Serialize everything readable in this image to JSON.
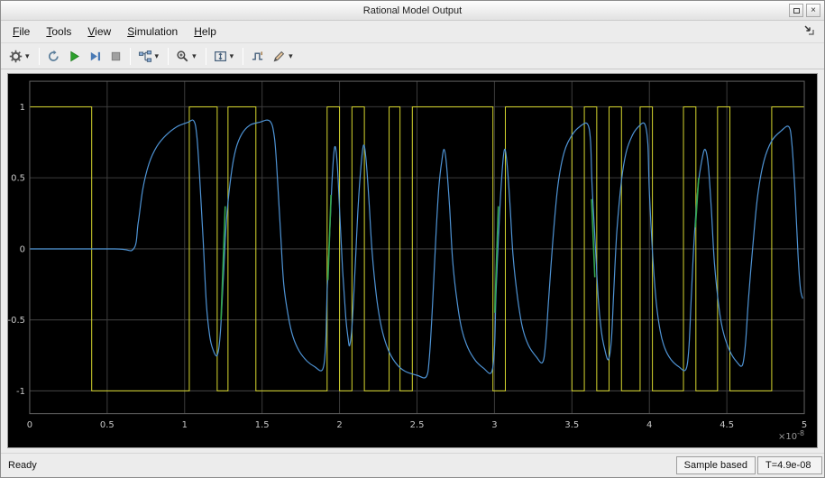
{
  "window": {
    "title": "Rational Model Output",
    "close_glyph": "×"
  },
  "menu": {
    "items": [
      {
        "label": "File"
      },
      {
        "label": "Tools"
      },
      {
        "label": "View"
      },
      {
        "label": "Simulation"
      },
      {
        "label": "Help"
      }
    ]
  },
  "toolbar": {
    "groups": [
      [
        {
          "name": "configuration",
          "icon": "gear-icon",
          "dropdown": true
        }
      ],
      [
        {
          "name": "step-back",
          "icon": "step-back-icon"
        },
        {
          "name": "run",
          "icon": "run-icon"
        },
        {
          "name": "step-forward",
          "icon": "step-forward-icon"
        },
        {
          "name": "stop",
          "icon": "stop-icon"
        }
      ],
      [
        {
          "name": "signal-selector",
          "icon": "signal-selector-icon",
          "dropdown": true
        }
      ],
      [
        {
          "name": "zoom",
          "icon": "zoom-icon",
          "dropdown": true
        }
      ],
      [
        {
          "name": "scale-axes",
          "icon": "scale-axes-icon",
          "dropdown": true
        }
      ],
      [
        {
          "name": "trigger",
          "icon": "trigger-icon"
        },
        {
          "name": "measurements",
          "icon": "measurements-icon",
          "dropdown": true
        }
      ]
    ]
  },
  "statusbar": {
    "ready": "Ready",
    "cells": [
      "Sample based",
      "T=4.9e-08"
    ]
  },
  "chart_data": {
    "type": "line",
    "title": "",
    "xlabel": "",
    "ylabel": "",
    "xlim": [
      0,
      5
    ],
    "ylim": [
      -1.16,
      1.18
    ],
    "x_scale_label": {
      "base": "×10",
      "exponent": "-8"
    },
    "grid": true,
    "background": "#000000",
    "grid_color": "#3d3d3d",
    "axes_border_color": "#606060",
    "tick_color": "#c8c8c8",
    "scale_label_color": "#9a9a9a",
    "xtick_values": [
      0,
      0.5,
      1,
      1.5,
      2,
      2.5,
      3,
      3.5,
      4,
      4.5,
      5
    ],
    "xtick_labels": [
      "0",
      "0.5",
      "1",
      "1.5",
      "2",
      "2.5",
      "3",
      "3.5",
      "4",
      "4.5",
      "5"
    ],
    "ytick_values": [
      1,
      0.5,
      0,
      -0.5,
      -1
    ],
    "ytick_labels": [
      "1",
      "0.5",
      "0",
      "-0.5",
      "-1"
    ],
    "series": [
      {
        "name": "input-square-wave",
        "color": "#d6d62e",
        "type": "step",
        "initial_value": 1,
        "levels": [
          1,
          -1
        ],
        "transition_times": [
          0.4,
          1.03,
          1.21,
          1.28,
          1.46,
          1.92,
          2.0,
          2.08,
          2.16,
          2.32,
          2.39,
          2.47,
          2.99,
          3.07,
          3.5,
          3.58,
          3.66,
          3.74,
          3.82,
          3.94,
          4.02,
          4.22,
          4.3,
          4.44,
          4.52,
          4.79
        ]
      },
      {
        "name": "output-response",
        "color": "#4e93d4",
        "type": "smooth",
        "points": [
          [
            0,
            0
          ],
          [
            0.55,
            0
          ],
          [
            0.67,
            0
          ],
          [
            0.7,
            0.18
          ],
          [
            0.73,
            0.42
          ],
          [
            0.77,
            0.6
          ],
          [
            0.82,
            0.72
          ],
          [
            0.88,
            0.8
          ],
          [
            0.95,
            0.86
          ],
          [
            1.02,
            0.89
          ],
          [
            1.06,
            0.9
          ],
          [
            1.08,
            0.78
          ],
          [
            1.1,
            0.45
          ],
          [
            1.12,
            0.05
          ],
          [
            1.14,
            -0.38
          ],
          [
            1.16,
            -0.6
          ],
          [
            1.18,
            -0.7
          ],
          [
            1.21,
            -0.75
          ],
          [
            1.23,
            -0.6
          ],
          [
            1.25,
            -0.2
          ],
          [
            1.27,
            0.2
          ],
          [
            1.3,
            0.52
          ],
          [
            1.33,
            0.7
          ],
          [
            1.37,
            0.81
          ],
          [
            1.42,
            0.87
          ],
          [
            1.48,
            0.89
          ],
          [
            1.55,
            0.9
          ],
          [
            1.58,
            0.78
          ],
          [
            1.6,
            0.48
          ],
          [
            1.62,
            0.1
          ],
          [
            1.64,
            -0.25
          ],
          [
            1.67,
            -0.48
          ],
          [
            1.7,
            -0.62
          ],
          [
            1.74,
            -0.72
          ],
          [
            1.79,
            -0.79
          ],
          [
            1.84,
            -0.83
          ],
          [
            1.89,
            -0.85
          ],
          [
            1.91,
            -0.68
          ],
          [
            1.92,
            -0.3
          ],
          [
            1.94,
            0.2
          ],
          [
            1.955,
            0.55
          ],
          [
            1.97,
            0.72
          ],
          [
            1.985,
            0.6
          ],
          [
            2.0,
            0.28
          ],
          [
            2.02,
            -0.15
          ],
          [
            2.04,
            -0.48
          ],
          [
            2.055,
            -0.63
          ],
          [
            2.065,
            -0.68
          ],
          [
            2.08,
            -0.55
          ],
          [
            2.1,
            -0.15
          ],
          [
            2.12,
            0.3
          ],
          [
            2.14,
            0.6
          ],
          [
            2.155,
            0.73
          ],
          [
            2.17,
            0.64
          ],
          [
            2.19,
            0.34
          ],
          [
            2.21,
            -0.02
          ],
          [
            2.24,
            -0.35
          ],
          [
            2.27,
            -0.55
          ],
          [
            2.31,
            -0.7
          ],
          [
            2.36,
            -0.8
          ],
          [
            2.42,
            -0.86
          ],
          [
            2.5,
            -0.89
          ],
          [
            2.56,
            -0.9
          ],
          [
            2.58,
            -0.76
          ],
          [
            2.6,
            -0.4
          ],
          [
            2.62,
            0.05
          ],
          [
            2.64,
            0.42
          ],
          [
            2.66,
            0.62
          ],
          [
            2.675,
            0.7
          ],
          [
            2.69,
            0.6
          ],
          [
            2.71,
            0.3
          ],
          [
            2.73,
            -0.08
          ],
          [
            2.76,
            -0.38
          ],
          [
            2.79,
            -0.57
          ],
          [
            2.83,
            -0.7
          ],
          [
            2.88,
            -0.79
          ],
          [
            2.93,
            -0.84
          ],
          [
            2.98,
            -0.87
          ],
          [
            3.0,
            -0.7
          ],
          [
            3.01,
            -0.32
          ],
          [
            3.03,
            0.18
          ],
          [
            3.05,
            0.55
          ],
          [
            3.065,
            0.7
          ],
          [
            3.08,
            0.61
          ],
          [
            3.1,
            0.32
          ],
          [
            3.12,
            -0.05
          ],
          [
            3.15,
            -0.35
          ],
          [
            3.18,
            -0.55
          ],
          [
            3.22,
            -0.68
          ],
          [
            3.27,
            -0.76
          ],
          [
            3.31,
            -0.8
          ],
          [
            3.33,
            -0.67
          ],
          [
            3.35,
            -0.35
          ],
          [
            3.38,
            0.1
          ],
          [
            3.41,
            0.45
          ],
          [
            3.45,
            0.68
          ],
          [
            3.5,
            0.8
          ],
          [
            3.55,
            0.86
          ],
          [
            3.6,
            0.88
          ],
          [
            3.62,
            0.76
          ],
          [
            3.63,
            0.45
          ],
          [
            3.65,
            0.05
          ],
          [
            3.67,
            -0.35
          ],
          [
            3.69,
            -0.58
          ],
          [
            3.71,
            -0.7
          ],
          [
            3.735,
            -0.78
          ],
          [
            3.755,
            -0.64
          ],
          [
            3.77,
            -0.3
          ],
          [
            3.79,
            0.12
          ],
          [
            3.82,
            0.48
          ],
          [
            3.85,
            0.68
          ],
          [
            3.89,
            0.8
          ],
          [
            3.93,
            0.86
          ],
          [
            3.97,
            0.88
          ],
          [
            3.99,
            0.74
          ],
          [
            4.0,
            0.4
          ],
          [
            4.02,
            -0.02
          ],
          [
            4.045,
            -0.38
          ],
          [
            4.07,
            -0.58
          ],
          [
            4.1,
            -0.7
          ],
          [
            4.14,
            -0.78
          ],
          [
            4.19,
            -0.83
          ],
          [
            4.235,
            -0.85
          ],
          [
            4.255,
            -0.7
          ],
          [
            4.27,
            -0.35
          ],
          [
            4.29,
            0.08
          ],
          [
            4.315,
            0.45
          ],
          [
            4.34,
            0.63
          ],
          [
            4.36,
            0.7
          ],
          [
            4.38,
            0.59
          ],
          [
            4.4,
            0.28
          ],
          [
            4.42,
            -0.1
          ],
          [
            4.45,
            -0.42
          ],
          [
            4.48,
            -0.6
          ],
          [
            4.52,
            -0.72
          ],
          [
            4.56,
            -0.79
          ],
          [
            4.6,
            -0.82
          ],
          [
            4.62,
            -0.67
          ],
          [
            4.64,
            -0.35
          ],
          [
            4.67,
            0.05
          ],
          [
            4.7,
            0.38
          ],
          [
            4.74,
            0.62
          ],
          [
            4.79,
            0.76
          ],
          [
            4.85,
            0.83
          ],
          [
            4.9,
            0.86
          ],
          [
            4.92,
            0.74
          ],
          [
            4.94,
            0.4
          ],
          [
            4.96,
            -0.05
          ],
          [
            4.975,
            -0.28
          ],
          [
            4.99,
            -0.35
          ]
        ]
      },
      {
        "name": "overlap-marks",
        "color": "#33a64c",
        "type": "segments",
        "segments": [
          [
            [
              1.235,
              -0.5
            ],
            [
              1.262,
              0.3
            ]
          ],
          [
            [
              1.925,
              -0.22
            ],
            [
              1.945,
              0.38
            ]
          ],
          [
            [
              3.002,
              -0.45
            ],
            [
              3.025,
              0.3
            ]
          ],
          [
            [
              3.627,
              0.35
            ],
            [
              3.648,
              -0.2
            ]
          ],
          [
            [
              4.297,
              0.15
            ],
            [
              4.318,
              0.5
            ]
          ]
        ]
      }
    ]
  }
}
